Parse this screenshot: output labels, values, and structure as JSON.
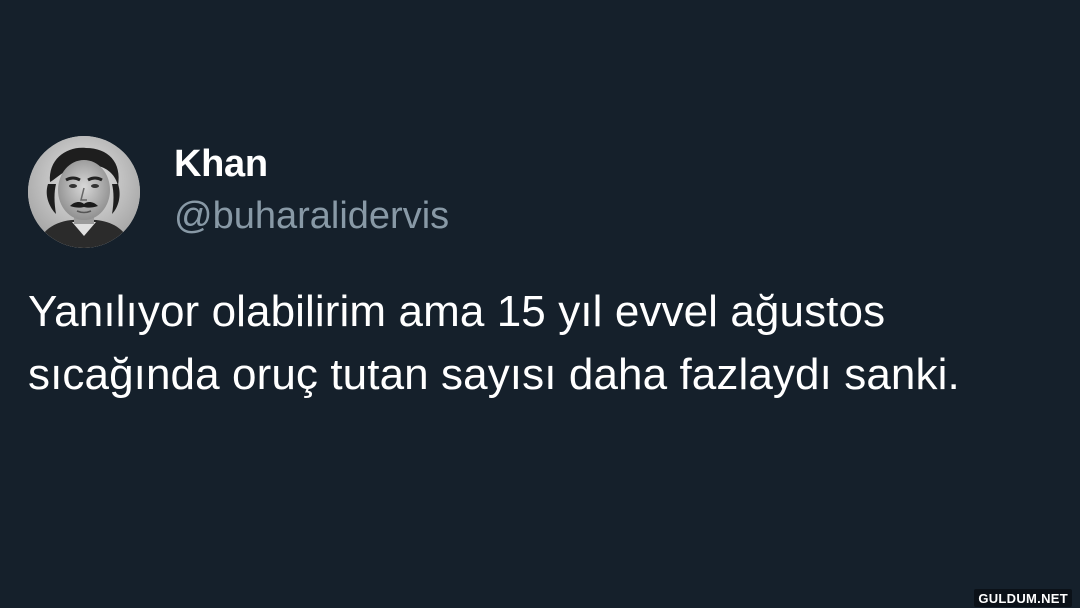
{
  "tweet": {
    "avatar_icon": "user-avatar-photo",
    "display_name": "Khan",
    "handle": "@buharalidervis",
    "text": "Yanılıyor olabilirim ama 15 yıl evvel ağustos sıcağında oruç tutan sayısı daha fazlaydı sanki."
  },
  "watermark": {
    "text": "GULDUM.NET"
  },
  "colors": {
    "background": "#15202b",
    "name": "#ffffff",
    "handle": "#8899a6",
    "text": "#ffffff"
  }
}
